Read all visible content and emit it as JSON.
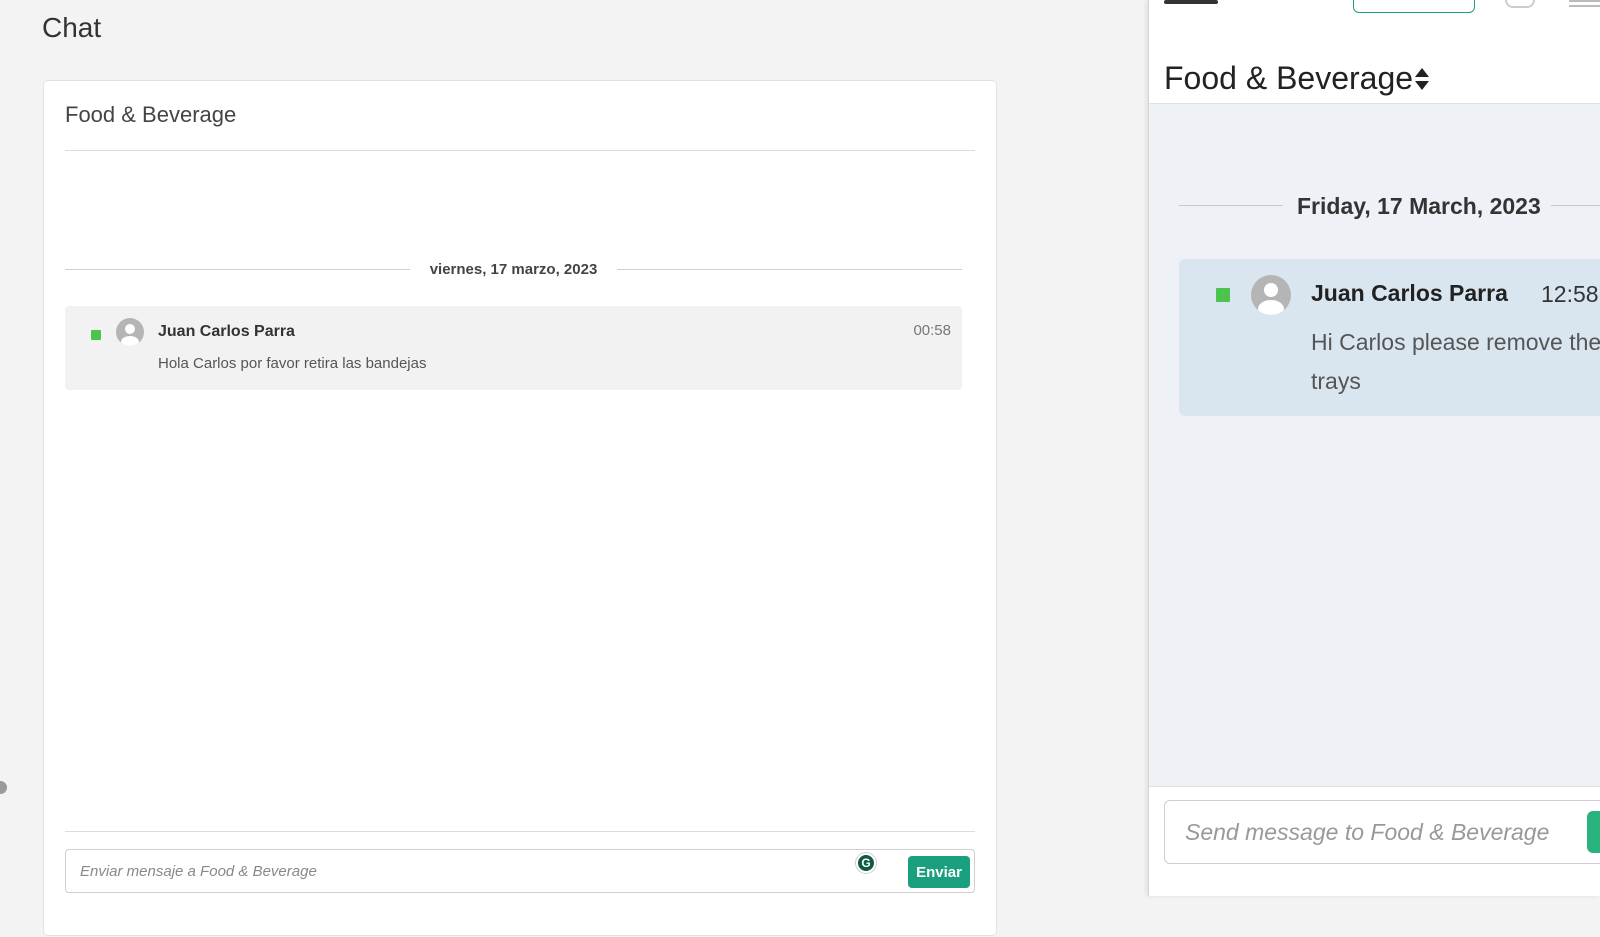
{
  "page": {
    "title": "Chat"
  },
  "desktop": {
    "channel_title": "Food & Beverage",
    "date_separator": "viernes, 17 marzo, 2023",
    "message": {
      "sender": "Juan Carlos Parra",
      "time": "00:58",
      "text": "Hola Carlos por favor retira las bandejas",
      "status": "online",
      "status_color": "#4cc34c"
    },
    "composer": {
      "placeholder": "Enviar mensaje a Food & Beverage",
      "value": "",
      "send_label": "Enviar",
      "send_color": "#1aa07f",
      "grammarly_glyph": "G"
    }
  },
  "mobile": {
    "channel_title": "Food & Beverage",
    "date_separator": "Friday, 17 March, 2023",
    "message": {
      "sender": "Juan Carlos Parra",
      "time": "12:58",
      "text_line1": "Hi Carlos please remove the",
      "text_line2": "trays",
      "status": "online",
      "bubble_color": "#d9e6f0"
    },
    "composer": {
      "placeholder": "Send message to Food & Beverage",
      "value": ""
    },
    "icons": [
      "menu-icon",
      "flag-icon",
      "hamburger-icon",
      "sort-icon",
      "avatar-icon"
    ]
  }
}
